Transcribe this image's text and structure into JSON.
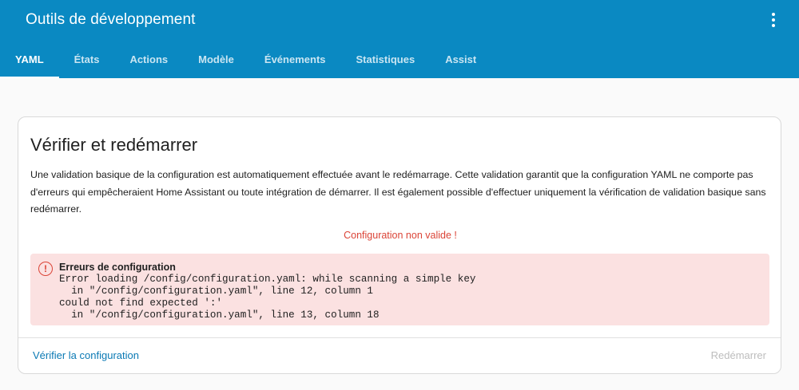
{
  "header": {
    "title": "Outils de développement",
    "menu_icon": "dots-vertical-icon"
  },
  "tabs": [
    {
      "label": "YAML",
      "active": true
    },
    {
      "label": "États",
      "active": false
    },
    {
      "label": "Actions",
      "active": false
    },
    {
      "label": "Modèle",
      "active": false
    },
    {
      "label": "Événements",
      "active": false
    },
    {
      "label": "Statistiques",
      "active": false
    },
    {
      "label": "Assist",
      "active": false
    }
  ],
  "card": {
    "title": "Vérifier et redémarrer",
    "description": "Une validation basique de la configuration est automatiquement effectuée avant le redémarrage. Cette validation garantit que la configuration YAML ne comporte pas d'erreurs qui empêcheraient Home Assistant ou toute intégration de démarrer. Il est également possible d'effectuer uniquement la vérification de validation basique sans redémarrer.",
    "status_message": "Configuration non valide !",
    "alert": {
      "icon": "alert-circle-icon",
      "icon_glyph": "!",
      "title": "Erreurs de configuration",
      "body": "Error loading /config/configuration.yaml: while scanning a simple key\n  in \"/config/configuration.yaml\", line 12, column 1\ncould not find expected ':'\n  in \"/config/configuration.yaml\", line 13, column 18"
    },
    "check_button": "Vérifier la configuration",
    "restart_button": "Redémarrer"
  },
  "colors": {
    "header_bg": "#0a89c2",
    "page_bg": "#fafafa",
    "error": "#db4437",
    "alert_bg": "#fbe1e1",
    "link": "#0a79b4",
    "disabled": "#bdbdbd"
  }
}
